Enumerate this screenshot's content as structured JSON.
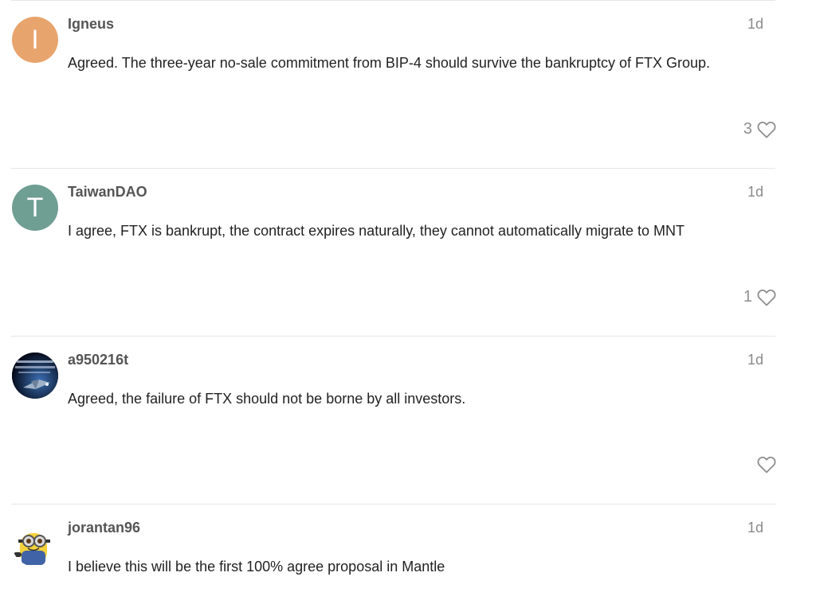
{
  "posts": [
    {
      "username": "Igneus",
      "date": "1d",
      "avatar_letter": "I",
      "avatar_color": "#e8a46d",
      "body": "Agreed. The three-year no-sale commitment from BIP-4 should survive the bankruptcy of FTX Group.",
      "like_count": "3"
    },
    {
      "username": "TaiwanDAO",
      "date": "1d",
      "avatar_letter": "T",
      "avatar_color": "#6f9e93",
      "body": "I agree, FTX is bankrupt, the contract expires naturally, they cannot automatically migrate to MNT",
      "like_count": "1"
    },
    {
      "username": "a950216t",
      "date": "1d",
      "avatar_icon": "space-ship-photo-avatar",
      "body": "Agreed, the failure of FTX should not be borne by all investors.",
      "like_count": ""
    },
    {
      "username": "jorantan96",
      "date": "1d",
      "avatar_icon": "minion-avatar",
      "body": "I believe this will be the first 100% agree proposal in Mantle"
    }
  ],
  "icons": {
    "like": "heart-icon"
  }
}
